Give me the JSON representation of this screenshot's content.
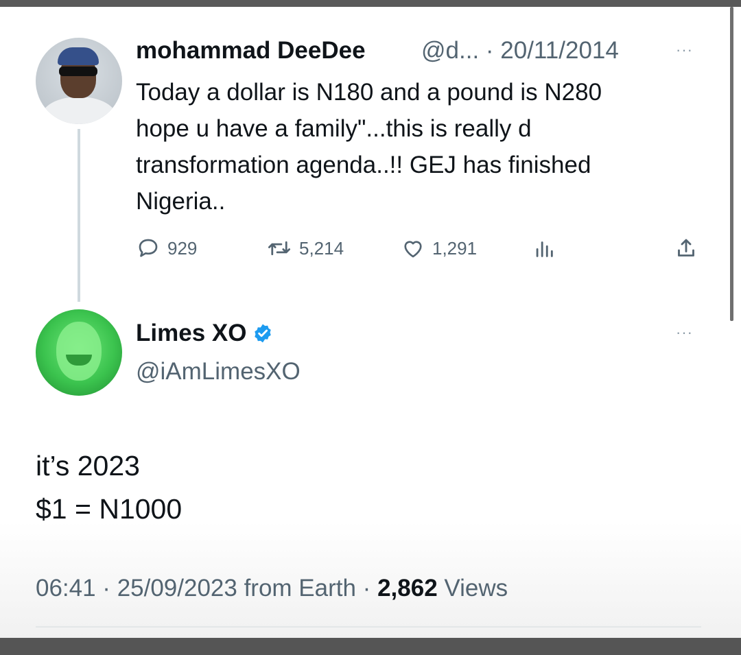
{
  "quoted_tweet": {
    "display_name": "mohammad DeeDee",
    "handle_date": "@d... · 20/11/2014",
    "more": "···",
    "text_lines": [
      "Today a dollar is N180 and a pound is N280",
      "hope u have a family\"...this is really d",
      "transformation agenda..!! GEJ has finished",
      "Nigeria.."
    ],
    "replies": "929",
    "retweets": "5,214",
    "likes": "1,291",
    "icons": [
      "reply-icon",
      "retweet-icon",
      "like-icon",
      "views-chart-icon",
      "share-icon"
    ]
  },
  "reply_tweet": {
    "display_name": "Limes XO",
    "verified_color": "#1d9bf0",
    "handle": "@iAmLimesXO",
    "more": "···",
    "text_lines": [
      "it’s 2023",
      "$1 = N1000"
    ],
    "timestamp": "06:41 · 25/09/2023 from Earth · ",
    "views_count": "2,862",
    "views_label": " Views"
  }
}
